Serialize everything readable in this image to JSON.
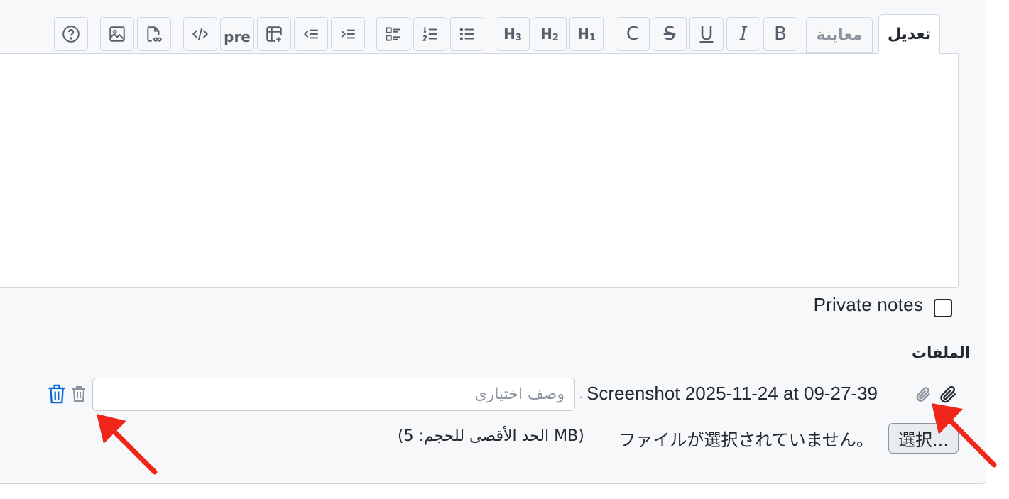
{
  "tabs": {
    "edit_label": "تعديل",
    "preview_label": "معاينة"
  },
  "toolbar": {
    "bold": "B",
    "italic": "I",
    "underline": "U",
    "strike": "S",
    "code_c": "C",
    "h1": "H",
    "h1_sub": "1",
    "h2": "H",
    "h2_sub": "2",
    "h3": "H",
    "h3_sub": "3",
    "pre": "pre",
    "icons": [
      "help-icon",
      "image-icon",
      "file-link-icon",
      "code-icon",
      "table-add-icon",
      "outdent-icon",
      "indent-icon",
      "task-list-icon",
      "ordered-list-icon",
      "unordered-list-icon"
    ]
  },
  "private_notes": {
    "label": "Private notes",
    "checked": false
  },
  "files": {
    "legend": "الملفات",
    "attachment": {
      "filename": "Screenshot 2025-11-24 at 09-27-39",
      "separator": ".",
      "description_placeholder": "وصف اختياري"
    },
    "choose_button": "選択...",
    "no_file_text": "ファイルが選択されていません。",
    "max_size_text": "(الحد الأقصى للحجم: 5 MB)"
  },
  "colors": {
    "accent_blue": "#0969da",
    "annotation_red": "#f0261a"
  }
}
